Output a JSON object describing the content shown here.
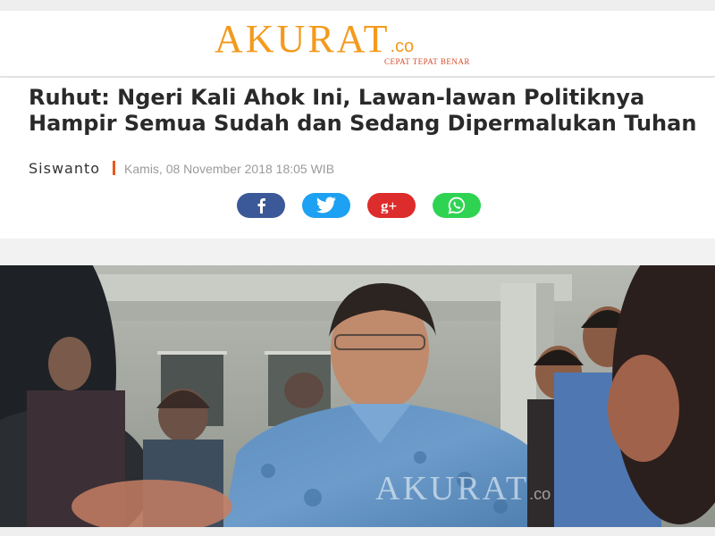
{
  "site": {
    "logo_main": "AKURAT",
    "logo_suffix": ".co",
    "tagline": "CEPAT TEPAT BENAR",
    "brand_color": "#f39a1c"
  },
  "article": {
    "title": "Ruhut: Ngeri Kali Ahok Ini, Lawan-lawan Politiknya Hampir Semua Sudah dan Sedang Dipermalukan Tuhan",
    "author": "Siswanto",
    "date": "Kamis, 08 November 2018 18:05 WIB"
  },
  "share": [
    {
      "name": "facebook",
      "icon": "facebook-icon",
      "color": "#3b5998"
    },
    {
      "name": "twitter",
      "icon": "twitter-icon",
      "color": "#1da1f2"
    },
    {
      "name": "google-plus",
      "icon": "google-plus-icon",
      "color": "#dd2c2c"
    },
    {
      "name": "whatsapp",
      "icon": "whatsapp-icon",
      "color": "#2fd352"
    }
  ],
  "photo": {
    "watermark_main": "AKURAT",
    "watermark_suffix": ".co"
  }
}
